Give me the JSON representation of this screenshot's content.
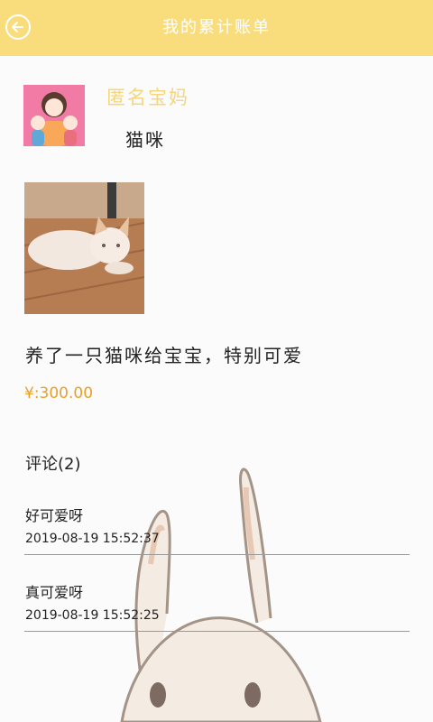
{
  "header": {
    "title": "我的累计账单",
    "back_icon": "back-arrow-icon"
  },
  "post": {
    "username": "匿名宝妈",
    "pet_name": "猫咪",
    "text": "养了一只猫咪给宝宝，特别可爱",
    "price": "¥:300.00"
  },
  "comments": {
    "title": "评论(2)",
    "items": [
      {
        "text": "好可爱呀",
        "time": "2019-08-19 15:52:37"
      },
      {
        "text": "真可爱呀",
        "time": "2019-08-19 15:52:25"
      }
    ]
  },
  "colors": {
    "header_bg": "#f9dd7c",
    "username": "#f4d67c",
    "price": "#e8a02b"
  }
}
